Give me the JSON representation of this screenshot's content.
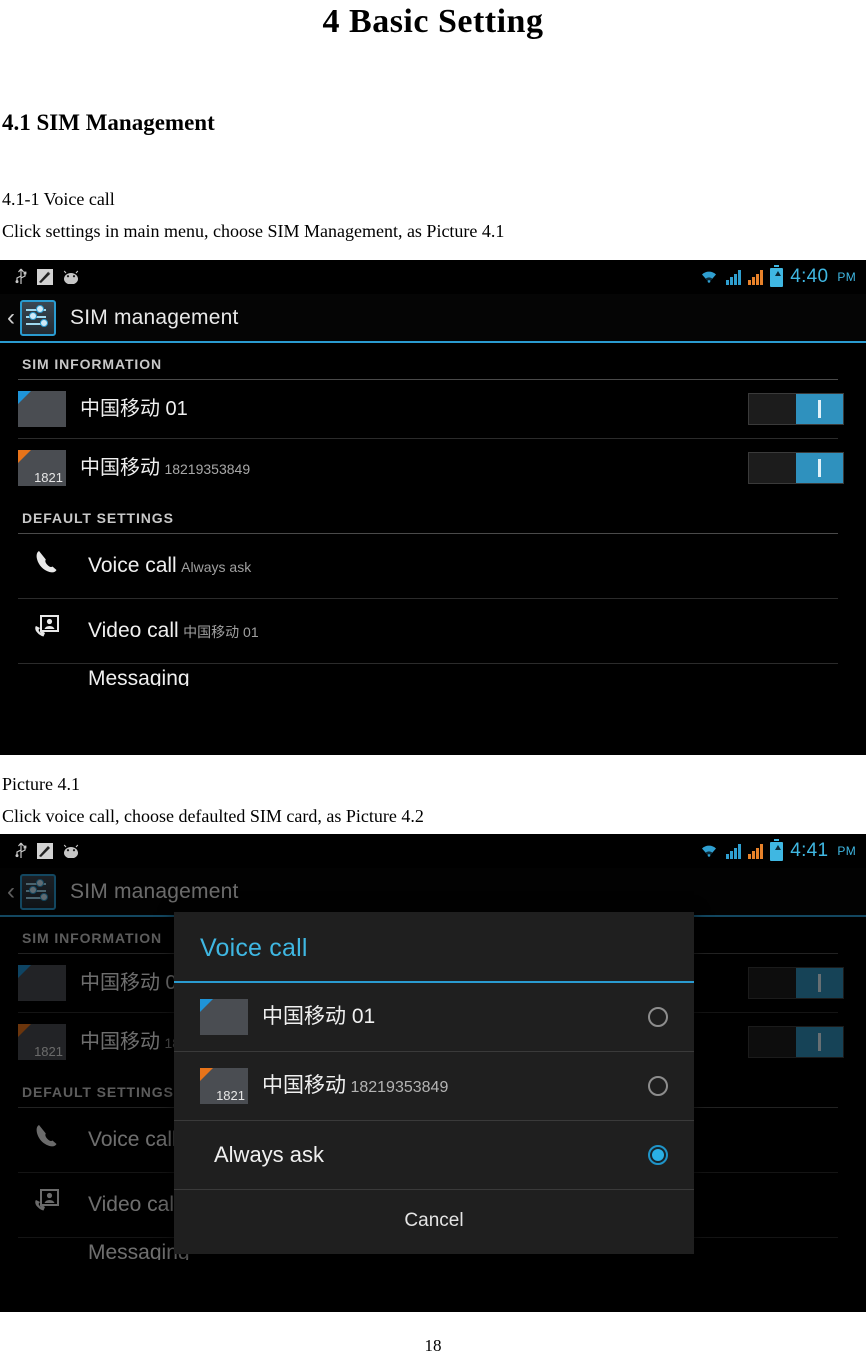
{
  "document": {
    "title": "4 Basic Setting",
    "heading": "4.1 SIM Management",
    "subheading": "4.1-1 Voice call",
    "intro_line": "Click settings in main menu, choose SIM Management, as Picture 4.1",
    "caption_1": "Picture 4.1",
    "intro_line_2": "Click voice call, choose defaulted SIM card, as Picture 4.2",
    "page_number": "18"
  },
  "colors": {
    "accent_blue": "#2a9bd0",
    "title_blue": "#3fb7e2",
    "sim1_corner": "#1f94d8",
    "sim2_corner": "#e8741a",
    "switch_on": "#2f91be"
  },
  "screenshot_1": {
    "statusbar": {
      "left_icons": [
        "usb-icon",
        "sd-card-icon",
        "android-robot-icon"
      ],
      "right_icons": [
        "wifi-icon",
        "signal-sim1-icon",
        "signal-sim2-icon",
        "battery-charging-icon"
      ],
      "time": "4:40",
      "ampm": "PM"
    },
    "actionbar": {
      "back_label": "‹",
      "app_icon": "sim-management-icon",
      "title": "SIM management"
    },
    "sections": [
      {
        "header": "SIM INFORMATION",
        "rows": [
          {
            "chip_label": "",
            "title": "中国移动 01",
            "subtitle": "",
            "switch": "on"
          },
          {
            "chip_label": "1821",
            "title": "中国移动",
            "subtitle": "18219353849",
            "switch": "on"
          }
        ]
      },
      {
        "header": "DEFAULT SETTINGS",
        "rows": [
          {
            "icon": "phone-icon",
            "title": "Voice call",
            "subtitle": "Always ask"
          },
          {
            "icon": "video-call-icon",
            "title": "Video call",
            "subtitle": "中国移动 01"
          },
          {
            "icon": "message-icon",
            "title": "Messaging",
            "subtitle": ""
          }
        ]
      }
    ]
  },
  "screenshot_2": {
    "statusbar": {
      "left_icons": [
        "usb-icon",
        "sd-card-icon",
        "android-robot-icon"
      ],
      "right_icons": [
        "wifi-icon",
        "signal-sim1-icon",
        "signal-sim2-icon",
        "battery-charging-icon"
      ],
      "time": "4:41",
      "ampm": "PM"
    },
    "actionbar": {
      "back_label": "‹",
      "app_icon": "sim-management-icon",
      "title": "SIM management"
    },
    "sections": [
      {
        "header": "SIM INFORMATION",
        "rows": [
          {
            "chip_label": "",
            "title": "中国移动 01",
            "subtitle": "",
            "switch": "on"
          },
          {
            "chip_label": "1821",
            "title": "中国移动",
            "subtitle": "18219353849",
            "switch": "on"
          }
        ]
      },
      {
        "header": "DEFAULT SETTINGS",
        "rows": [
          {
            "icon": "phone-icon",
            "title": "Voice call",
            "subtitle": "Always ask"
          },
          {
            "icon": "video-call-icon",
            "title": "Video call",
            "subtitle": "中国移动 01"
          },
          {
            "icon": "message-icon",
            "title": "Messaging",
            "subtitle": ""
          }
        ]
      }
    ],
    "dialog": {
      "title": "Voice call",
      "options": [
        {
          "chip_label": "",
          "title": "中国移动 01",
          "subtitle": "",
          "selected": false
        },
        {
          "chip_label": "1821",
          "title": "中国移动",
          "subtitle": "18219353849",
          "selected": false
        },
        {
          "chip_label": null,
          "title": "Always ask",
          "subtitle": "",
          "selected": true
        }
      ],
      "cancel_label": "Cancel"
    }
  }
}
